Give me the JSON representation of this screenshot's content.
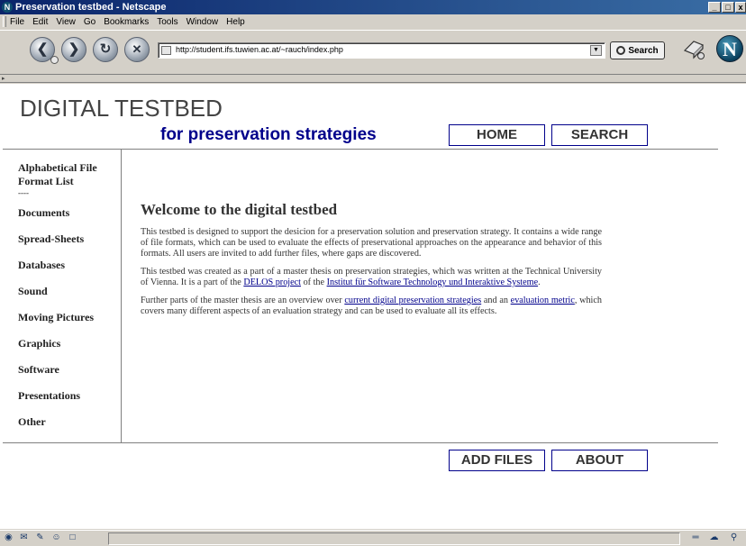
{
  "window": {
    "title": "Preservation testbed - Netscape",
    "controls": [
      "_",
      "□",
      "x"
    ]
  },
  "menu": [
    "File",
    "Edit",
    "View",
    "Go",
    "Bookmarks",
    "Tools",
    "Window",
    "Help"
  ],
  "toolbar": {
    "back_icon": "back-arrow-icon",
    "forward_icon": "forward-arrow-icon",
    "reload_icon": "reload-icon",
    "stop_icon": "stop-icon",
    "url": "http://student.ifs.tuwien.ac.at/~rauch/index.php",
    "search_label": "Search"
  },
  "page": {
    "brand": "DIGITAL TESTBED",
    "subtitle": "for preservation strategies",
    "top_buttons": [
      "HOME",
      "SEARCH"
    ],
    "bottom_buttons": [
      "ADD FILES",
      "ABOUT"
    ],
    "sidebar": {
      "first_line1": "Alphabetical File",
      "first_line2": "Format List",
      "separator": "----",
      "items": [
        "Documents",
        "Spread-Sheets",
        "Databases",
        "Sound",
        "Moving Pictures",
        "Graphics",
        "Software",
        "Presentations",
        "Other"
      ]
    },
    "heading": "Welcome to the digital testbed",
    "p1": "This testbed is designed to support the desicion for a preservation solution and preservation strategy. It contains a wide range of file formats, which can be used to evaluate the effects of preservational approaches on the appearance and behavior of this formats. All users are invited to add further files, where gaps are discovered.",
    "p2_a": "This testbed was created as a part of a master thesis on preservation strategies, which was written at the Technical University of Vienna. It is a part of the ",
    "p2_link1": "DELOS project",
    "p2_b": " of the ",
    "p2_link2": "Institut für Software Technology und Interaktive Systeme",
    "p2_c": ".",
    "p3_a": "Further parts of the master thesis are an overview over ",
    "p3_link1": "current digital preservation strategies",
    "p3_b": " and an ",
    "p3_link2": "evaluation metric",
    "p3_c": ", which covers many different aspects of an evaluation strategy and can be used to evaluate all its effects."
  }
}
